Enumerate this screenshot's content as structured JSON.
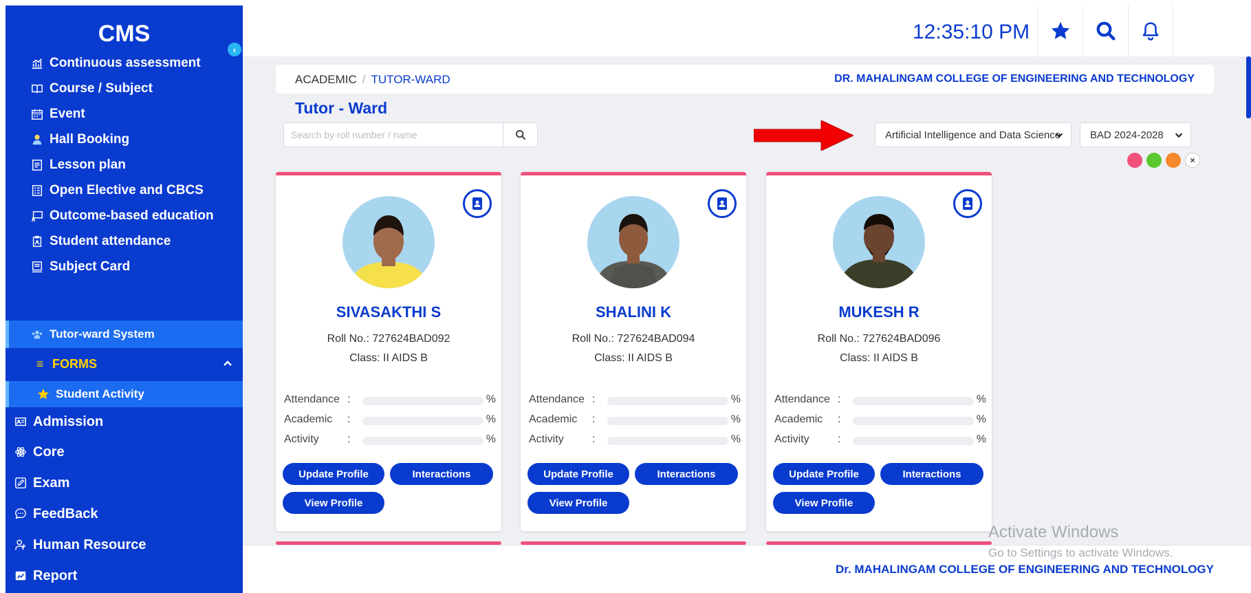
{
  "app": {
    "brand": "CMS",
    "collapse_icon": "chevron-left-icon"
  },
  "sidebar": {
    "items": [
      {
        "label": "Continuous assessment",
        "icon": "chart-icon"
      },
      {
        "label": "Course / Subject",
        "icon": "book-icon"
      },
      {
        "label": "Event",
        "icon": "calendar-icon"
      },
      {
        "label": "Hall Booking",
        "icon": "person-icon"
      },
      {
        "label": "Lesson plan",
        "icon": "document-icon"
      },
      {
        "label": "Open Elective and CBCS",
        "icon": "list-icon"
      },
      {
        "label": "Outcome-based education",
        "icon": "presentation-icon"
      },
      {
        "label": "Student attendance",
        "icon": "clipboard-icon"
      },
      {
        "label": "Subject Card",
        "icon": "card-icon"
      },
      {
        "label": "Tutor-ward System",
        "icon": "group-icon",
        "active": true
      }
    ],
    "forms": {
      "label": "FORMS",
      "icon": "menu-icon",
      "expanded": true
    },
    "forms_items": [
      {
        "label": "Student Activity",
        "icon": "star-icon",
        "active": true
      }
    ],
    "modules": [
      {
        "label": "Admission",
        "icon": "id-card-icon"
      },
      {
        "label": "Core",
        "icon": "atom-icon"
      },
      {
        "label": "Exam",
        "icon": "edit-icon"
      },
      {
        "label": "FeedBack",
        "icon": "chat-icon"
      },
      {
        "label": "Human Resource",
        "icon": "add-user-icon"
      },
      {
        "label": "Report",
        "icon": "report-icon"
      }
    ]
  },
  "header": {
    "time": "12:35:10 PM"
  },
  "breadcrumb": {
    "root": "ACADEMIC",
    "separator": "/",
    "current": "TUTOR-WARD"
  },
  "college": "DR. MAHALINGAM COLLEGE OF ENGINEERING AND TECHNOLOGY",
  "page": {
    "title": "Tutor - Ward"
  },
  "search": {
    "placeholder": "Search by roll number / name",
    "value": ""
  },
  "filters": {
    "department": "Artificial Intelligence and Data Science",
    "batch": "BAD 2024-2028"
  },
  "legend_colors": [
    "#f0507a",
    "#5ac82e",
    "#f7882c"
  ],
  "metric_labels": {
    "attendance": "Attendance",
    "academic": "Academic",
    "activity": "Activity",
    "colon": ":",
    "percent": "%"
  },
  "buttons": {
    "update_profile": "Update Profile",
    "interactions": "Interactions",
    "view_profile": "View Profile"
  },
  "students": [
    {
      "name": "SIVASAKTHI S",
      "roll": "Roll No.: 727624BAD092",
      "class": "Class: II AIDS B"
    },
    {
      "name": "SHALINI K",
      "roll": "Roll No.: 727624BAD094",
      "class": "Class: II AIDS B"
    },
    {
      "name": "MUKESH R",
      "roll": "Roll No.: 727624BAD096",
      "class": "Class: II AIDS B"
    }
  ],
  "footer": {
    "text": "Dr. MAHALINGAM COLLEGE OF ENGINEERING AND TECHNOLOGY"
  },
  "watermark": {
    "line1": "Activate Windows",
    "line2": "Go to Settings to activate Windows."
  },
  "colors": {
    "primary": "#0a3bcf",
    "accent_pink": "#f0507a",
    "active_nav": "#1b6cf0",
    "forms_yellow": "#ffd400"
  }
}
